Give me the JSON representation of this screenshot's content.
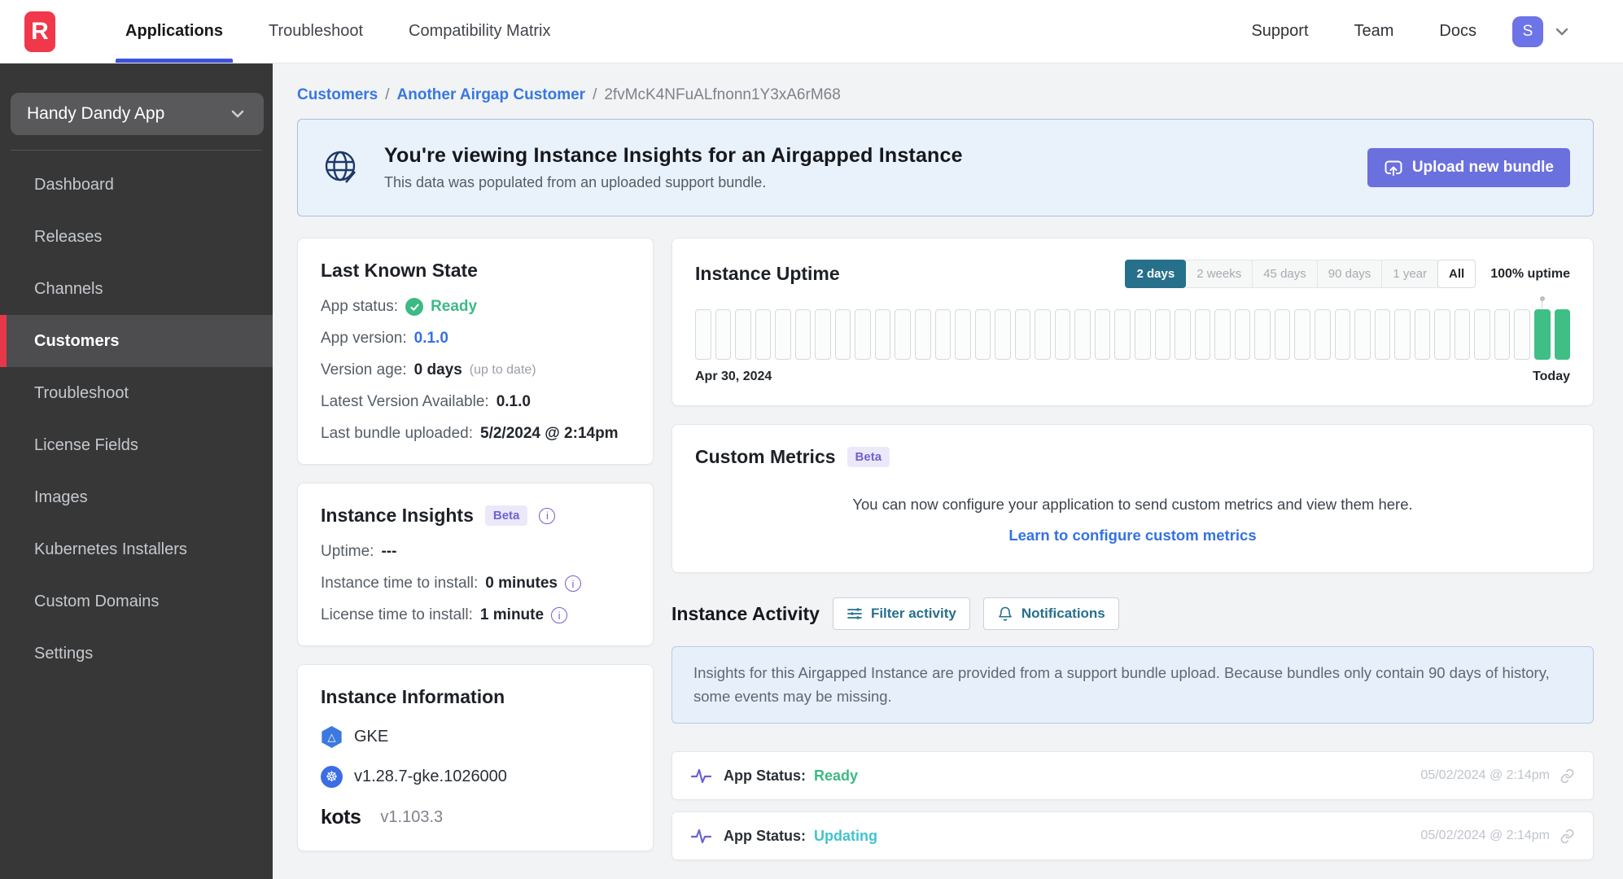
{
  "header": {
    "logo_letter": "R",
    "tabs": [
      {
        "label": "Applications",
        "active": true
      },
      {
        "label": "Troubleshoot",
        "active": false
      },
      {
        "label": "Compatibility Matrix",
        "active": false
      }
    ],
    "links": [
      "Support",
      "Team",
      "Docs"
    ],
    "avatar_letter": "S"
  },
  "sidebar": {
    "app_selector": "Handy Dandy App",
    "items": [
      {
        "label": "Dashboard",
        "active": false
      },
      {
        "label": "Releases",
        "active": false
      },
      {
        "label": "Channels",
        "active": false
      },
      {
        "label": "Customers",
        "active": true
      },
      {
        "label": "Troubleshoot",
        "active": false
      },
      {
        "label": "License Fields",
        "active": false
      },
      {
        "label": "Images",
        "active": false
      },
      {
        "label": "Kubernetes Installers",
        "active": false
      },
      {
        "label": "Custom Domains",
        "active": false
      },
      {
        "label": "Settings",
        "active": false
      }
    ]
  },
  "breadcrumb": {
    "links": [
      "Customers",
      "Another Airgap Customer"
    ],
    "separator": "/",
    "current": "2fvMcK4NFuALfnonn1Y3xA6rM68"
  },
  "banner": {
    "title": "You're viewing Instance Insights for an Airgapped Instance",
    "subtitle": "This data was populated from an uploaded support bundle.",
    "button": "Upload new bundle"
  },
  "last_known_state": {
    "title": "Last Known State",
    "app_status_label": "App status:",
    "app_status_value": "Ready",
    "app_version_label": "App version:",
    "app_version_value": "0.1.0",
    "version_age_label": "Version age:",
    "version_age_value": "0 days",
    "version_age_note": "(up to date)",
    "latest_version_label": "Latest Version Available:",
    "latest_version_value": "0.1.0",
    "last_bundle_label": "Last bundle uploaded:",
    "last_bundle_value": "5/2/2024 @ 2:14pm"
  },
  "instance_insights": {
    "title": "Instance Insights",
    "beta": "Beta",
    "uptime_label": "Uptime:",
    "uptime_value": "---",
    "time_to_install_label": "Instance time to install:",
    "time_to_install_value": "0 minutes",
    "license_time_label": "License time to install:",
    "license_time_value": "1 minute"
  },
  "instance_information": {
    "title": "Instance Information",
    "distribution": "GKE",
    "k8s_version": "v1.28.7-gke.1026000",
    "kots_label": "kots",
    "kots_version": "v1.103.3"
  },
  "instance_uptime": {
    "title": "Instance Uptime",
    "ranges": [
      "2 days",
      "2 weeks",
      "45 days",
      "90 days",
      "1 year",
      "All"
    ],
    "active_range": "2 days",
    "uptime_text": "100% uptime",
    "start_label": "Apr 30, 2024",
    "end_label": "Today",
    "chart": {
      "total_bars": 44,
      "green_bars": 2
    }
  },
  "custom_metrics": {
    "title": "Custom Metrics",
    "beta": "Beta",
    "description": "You can now configure your application to send custom metrics and view them here.",
    "link": "Learn to configure custom metrics"
  },
  "instance_activity": {
    "title": "Instance Activity",
    "filter_button": "Filter activity",
    "notifications_button": "Notifications",
    "notice": "Insights for this Airgapped Instance are provided from a support bundle upload. Because bundles only contain 90 days of history, some events may be missing.",
    "events": [
      {
        "label": "App Status:",
        "value": "Ready",
        "value_color": "#3cba83",
        "timestamp": "05/02/2024 @ 2:14pm"
      },
      {
        "label": "App Status:",
        "value": "Updating",
        "value_color": "#41c3cd",
        "timestamp": "05/02/2024 @ 2:14pm"
      }
    ]
  },
  "colors": {
    "accent_blue": "#3d53dd",
    "brand_red": "#f0384a",
    "indigo": "#6a70de",
    "teal": "#26708c",
    "green": "#3cba83",
    "updating_teal": "#41c3cd",
    "link_blue": "#3472e2"
  }
}
